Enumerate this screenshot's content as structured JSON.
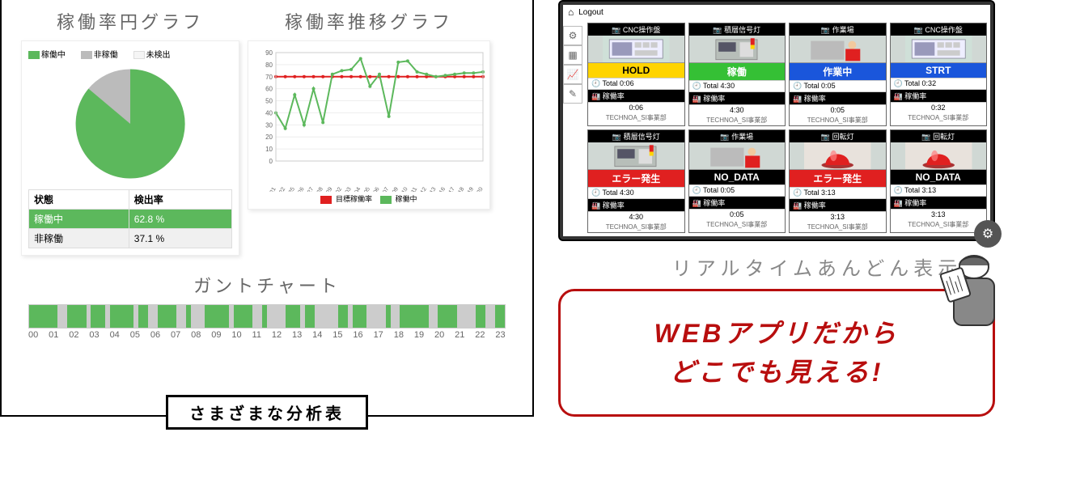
{
  "left": {
    "pie_title": "稼働率円グラフ",
    "line_title": "稼働率推移グラフ",
    "gantt_title": "ガントチャート",
    "bottom_label": "さまざまな分析表",
    "pie_legend": {
      "running": "稼働中",
      "stopped": "非稼働",
      "undetected": "未検出"
    },
    "pie_table": {
      "h_state": "状態",
      "h_rate": "検出率",
      "r1_state": "稼働中",
      "r1_rate": "62.8 %",
      "r2_state": "非稼働",
      "r2_rate": "37.1 %"
    },
    "line_legend": {
      "target": "目標稼働率",
      "running": "稼働中"
    },
    "gantt_hours": [
      "00",
      "01",
      "02",
      "03",
      "04",
      "05",
      "06",
      "07",
      "08",
      "09",
      "10",
      "11",
      "12",
      "13",
      "14",
      "15",
      "16",
      "17",
      "18",
      "19",
      "20",
      "21",
      "22",
      "23"
    ]
  },
  "right": {
    "logout_label": " Logout",
    "andon_title": "リアルタイムあんどん表示",
    "callout_l1": "WEBアプリだから",
    "callout_l2": "どこでも見える!",
    "org": "TECHNOA_SI事業部",
    "labels": {
      "rate": "稼働率",
      "total": "Total"
    },
    "cells": [
      {
        "name": "CNC操作盤",
        "status": "HOLD",
        "cls": "st-yellow",
        "total": "0:06",
        "val": "0:06",
        "thumb": "panel"
      },
      {
        "name": "積層信号灯",
        "status": "稼働",
        "cls": "st-green",
        "total": "4:30",
        "val": "4:30",
        "thumb": "machine"
      },
      {
        "name": "作業場",
        "status": "作業中",
        "cls": "st-blue",
        "total": "0:05",
        "val": "0:05",
        "thumb": "worker"
      },
      {
        "name": "CNC操作盤",
        "status": "STRT",
        "cls": "st-blue",
        "total": "0:32",
        "val": "0:32",
        "thumb": "panel"
      },
      {
        "name": "積層信号灯",
        "status": "エラー発生",
        "cls": "st-red",
        "total": "4:30",
        "val": "4:30",
        "thumb": "machine"
      },
      {
        "name": "作業場",
        "status": "NO_DATA",
        "cls": "st-black",
        "total": "0:05",
        "val": "0:05",
        "thumb": "worker"
      },
      {
        "name": "回転灯",
        "status": "エラー発生",
        "cls": "st-red",
        "total": "3:13",
        "val": "3:13",
        "thumb": "lamp"
      },
      {
        "name": "回転灯",
        "status": "NO_DATA",
        "cls": "st-black",
        "total": "3:13",
        "val": "3:13",
        "thumb": "lamp"
      }
    ]
  },
  "chart_data": [
    {
      "type": "pie",
      "title": "稼働率円グラフ",
      "series": [
        {
          "name": "稼働中",
          "value": 62.8,
          "color": "#5cb85c"
        },
        {
          "name": "非稼働",
          "value": 37.1,
          "color": "#bbbbbb"
        },
        {
          "name": "未検出",
          "value": 0.1,
          "color": "#f5f5f5"
        }
      ]
    },
    {
      "type": "line",
      "title": "稼働率推移グラフ",
      "xlabel": "",
      "ylabel": "",
      "ylim": [
        0,
        90
      ],
      "categories": [
        "11/21",
        "11/22",
        "11/25",
        "11/26",
        "11/27",
        "11/28",
        "11/29",
        "12/02",
        "12/03",
        "12/04",
        "12/05",
        "12/06",
        "12/07",
        "12/09",
        "12/10",
        "12/11",
        "12/12",
        "12/13",
        "12/16",
        "12/17",
        "12/18",
        "12/19",
        "12/20"
      ],
      "series": [
        {
          "name": "目標稼働率",
          "color": "#e02020",
          "values": [
            70,
            70,
            70,
            70,
            70,
            70,
            70,
            70,
            70,
            70,
            70,
            70,
            70,
            70,
            70,
            70,
            70,
            70,
            70,
            70,
            70,
            70,
            70
          ]
        },
        {
          "name": "稼働中",
          "color": "#5cb85c",
          "values": [
            40,
            27,
            55,
            30,
            60,
            32,
            72,
            75,
            76,
            85,
            62,
            72,
            37,
            82,
            83,
            74,
            72,
            70,
            71,
            72,
            73,
            73,
            74
          ]
        }
      ]
    },
    {
      "type": "bar",
      "title": "ガントチャート",
      "categories": [
        "00",
        "01",
        "02",
        "03",
        "04",
        "05",
        "06",
        "07",
        "08",
        "09",
        "10",
        "11",
        "12",
        "13",
        "14",
        "15",
        "16",
        "17",
        "18",
        "19",
        "20",
        "21",
        "22",
        "23"
      ],
      "note": "timeline gantt; green=稼働, grey=非稼働; approximate segment widths in %",
      "segments": [
        6,
        2,
        4,
        1,
        3,
        1,
        5,
        1,
        2,
        2,
        4,
        2,
        1,
        3,
        5,
        1,
        4,
        2,
        1,
        4,
        3,
        1,
        2,
        5,
        2,
        1,
        3,
        4,
        1,
        2,
        6,
        2,
        4,
        2,
        2,
        2,
        2,
        2
      ],
      "segcolors": [
        "g",
        "x",
        "g",
        "x",
        "g",
        "x",
        "g",
        "x",
        "g",
        "x",
        "g",
        "x",
        "g",
        "x",
        "g",
        "x",
        "g",
        "x",
        "g",
        "x",
        "g",
        "x",
        "g",
        "x",
        "g",
        "x",
        "g",
        "x",
        "g",
        "x",
        "g",
        "x",
        "g",
        "x",
        "x",
        "g",
        "x",
        "g"
      ]
    }
  ]
}
